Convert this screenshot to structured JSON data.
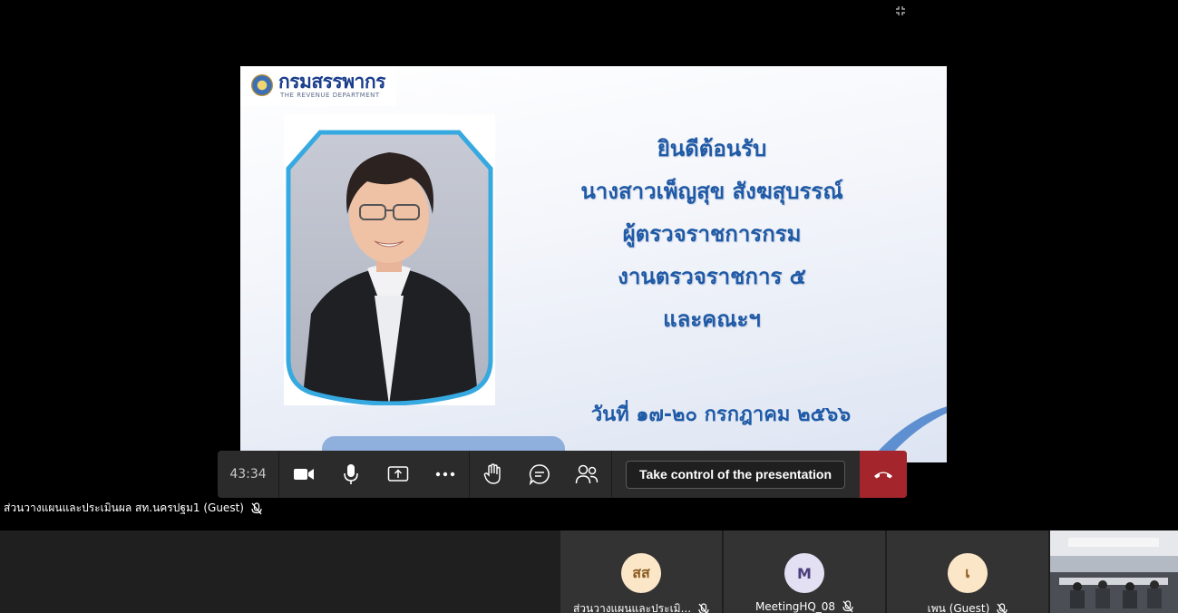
{
  "slide": {
    "logo": {
      "thai": "กรมสรรพากร",
      "english": "THE REVENUE DEPARTMENT"
    },
    "lines": [
      "ยินดีต้อนรับ",
      "นางสาวเพ็ญสุข สังฆสุบรรณ์",
      "ผู้ตรวจราชการกรม",
      "งานตรวจราชการ ๕",
      "และคณะฯ"
    ],
    "date": "วันที่ ๑๗-๒๐ กรกฎาคม ๒๕๖๖",
    "colors": {
      "text": "#1f5aa6",
      "frame": "#36a9e1"
    }
  },
  "controls": {
    "timer": "43:34",
    "icons": [
      "video-camera-icon",
      "microphone-icon",
      "share-screen-icon",
      "more-options-icon",
      "raise-hand-icon",
      "chat-icon",
      "participants-icon",
      "hang-up-icon"
    ],
    "take_control_label": "Take control of the presentation",
    "hangup_color": "#a4262c"
  },
  "presenter": {
    "name": "ส่วนวางแผนและประเมินผล สท.นครปฐม1 (Guest)"
  },
  "participants": [
    {
      "initials": "สส",
      "name": "ส่วนวางแผนและประเมิ...",
      "avatar_bg": "#fbe6c8",
      "avatar_fg": "#8a5a1e"
    },
    {
      "initials": "M",
      "name": "MeetingHQ_08",
      "avatar_bg": "#e4e0f3",
      "avatar_fg": "#4b3f7a"
    },
    {
      "initials": "เ",
      "name": "เพน (Guest)",
      "avatar_bg": "#fbe6c8",
      "avatar_fg": "#8a5a1e"
    }
  ]
}
